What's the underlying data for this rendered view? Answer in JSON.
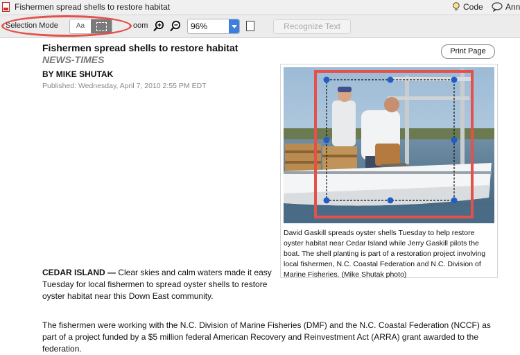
{
  "window": {
    "title": "Fishermen spread shells to restore habitat",
    "code_label": "Code",
    "ann_label": "Ann"
  },
  "toolbar": {
    "selection_mode_label": "Selection Mode",
    "text_mode_label": "Aa",
    "zoom_label": "oom",
    "zoom_value": "96%",
    "recognize_label": "Recognize Text"
  },
  "article": {
    "title": "Fishermen spread shells to restore habitat",
    "source": "NEWS-TIMES",
    "byline": "BY MIKE SHUTAK",
    "published": "Published: Wednesday, April 7, 2010 2:55 PM EDT",
    "print_label": "Print Page",
    "caption": "David Gaskill spreads oyster shells Tuesday to help restore oyster habitat near Cedar Island while Jerry Gaskill pilots the boat. The shell planting is part of a restoration project involving local fishermen, N.C. Coastal Federation and N.C. Division of Marine Fisheries. (Mike Shutak photo)",
    "lead_dateline": "CEDAR ISLAND —",
    "lead_text": " Clear skies and calm waters made it easy Tuesday for local fishermen to spread oyster shells to restore oyster habitat near this Down East community.",
    "paragraph2": "The fishermen were working with the N.C. Division of Marine Fisheries (DMF) and the N.C. Coastal Federation (NCCF) as part of a project funded by a $5 million federal American Recovery and Reinvestment Act (ARRA) grant awarded to the federation."
  },
  "colors": {
    "highlight": "#e4514a",
    "handle": "#1f5fc4",
    "zoom_caret": "#3d7fe0"
  }
}
